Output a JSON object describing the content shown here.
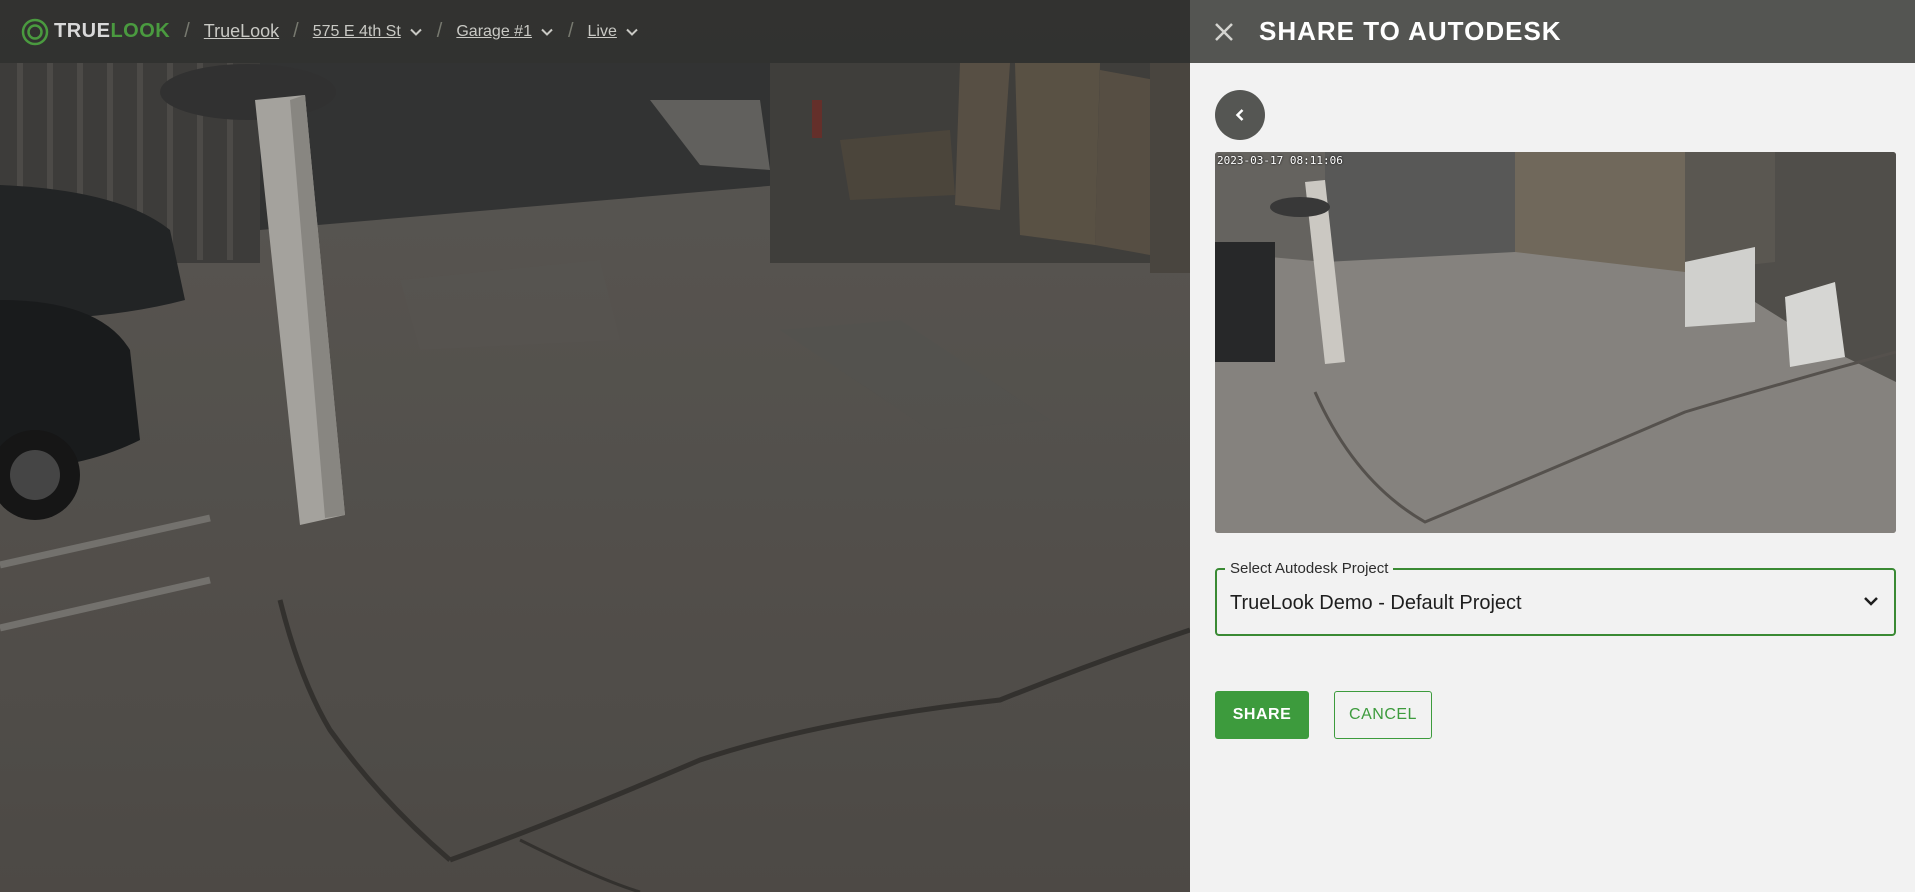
{
  "brand": {
    "logo_true": "TRUE",
    "logo_look": "LOOK",
    "accent": "#3d9b3d"
  },
  "breadcrumb": {
    "app": "TrueLook",
    "site": "575 E 4th St",
    "camera": "Garage #1",
    "mode": "Live"
  },
  "icons": {
    "logo": "truelook-logo-icon",
    "chevron": "chevron-down-icon",
    "close": "close-icon",
    "back": "chevron-left-icon"
  },
  "panel": {
    "title": "SHARE TO AUTODESK",
    "snapshot_timestamp": "2023-03-17 08:11:06",
    "project_select": {
      "label": "Select Autodesk Project",
      "value": "TrueLook Demo - Default Project"
    },
    "share_label": "SHARE",
    "cancel_label": "CANCEL"
  }
}
